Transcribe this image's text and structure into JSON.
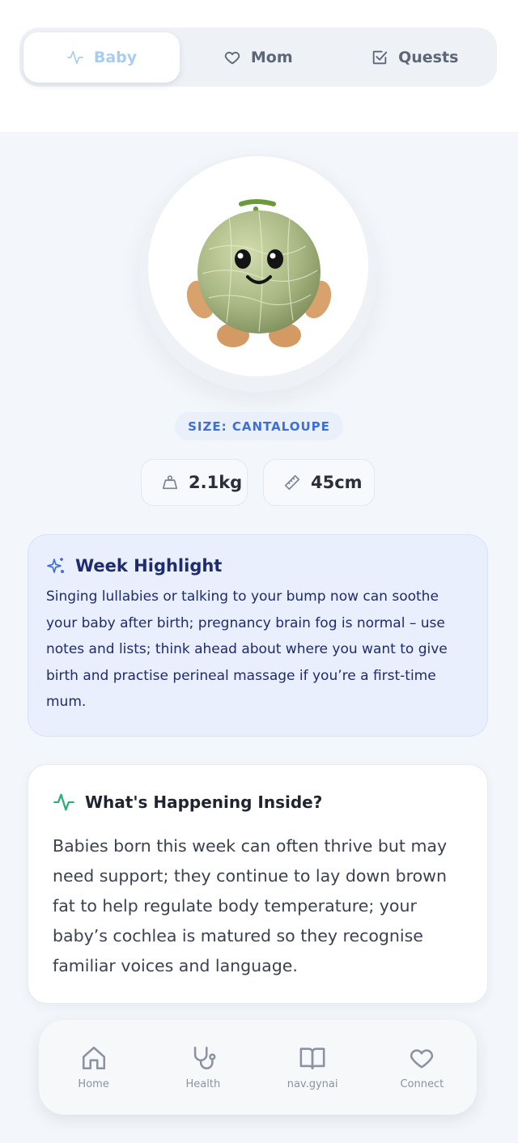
{
  "tabs": [
    {
      "label": "Baby",
      "icon": "activity-icon",
      "active": true
    },
    {
      "label": "Mom",
      "icon": "heart-icon",
      "active": false
    },
    {
      "label": "Quests",
      "icon": "checkbox-icon",
      "active": false
    }
  ],
  "baby": {
    "size_label": "SIZE: CANTALOUPE",
    "weight": "2.1kg",
    "length": "45cm",
    "fruit_icon": "cantaloupe-mascot"
  },
  "highlight": {
    "title": "Week Highlight",
    "body": "Singing lullabies or talking to your bump now can soothe your baby after birth; pregnancy brain fog is normal – use notes and lists; think ahead about where you want to give birth and practise perineal massage if you’re a first-time mum."
  },
  "inside": {
    "title": "What's Happening Inside?",
    "body": "Babies born this week can often thrive but may need support; they continue to lay down brown fat to help regulate body temperature; your baby’s cochlea is matured so they recognise familiar voices and language."
  },
  "nav": [
    {
      "label": "Home",
      "icon": "home-icon"
    },
    {
      "label": "Health",
      "icon": "stethoscope-icon"
    },
    {
      "label": "nav.gynai",
      "icon": "book-icon"
    },
    {
      "label": "Connect",
      "icon": "heart-icon"
    }
  ],
  "colors": {
    "accent": "#3e6fd8",
    "active_tab_text": "#a9cdf0",
    "highlight_bg": "#e9effc",
    "highlight_text": "#1e2b6e",
    "pulse_green": "#2fae78"
  }
}
